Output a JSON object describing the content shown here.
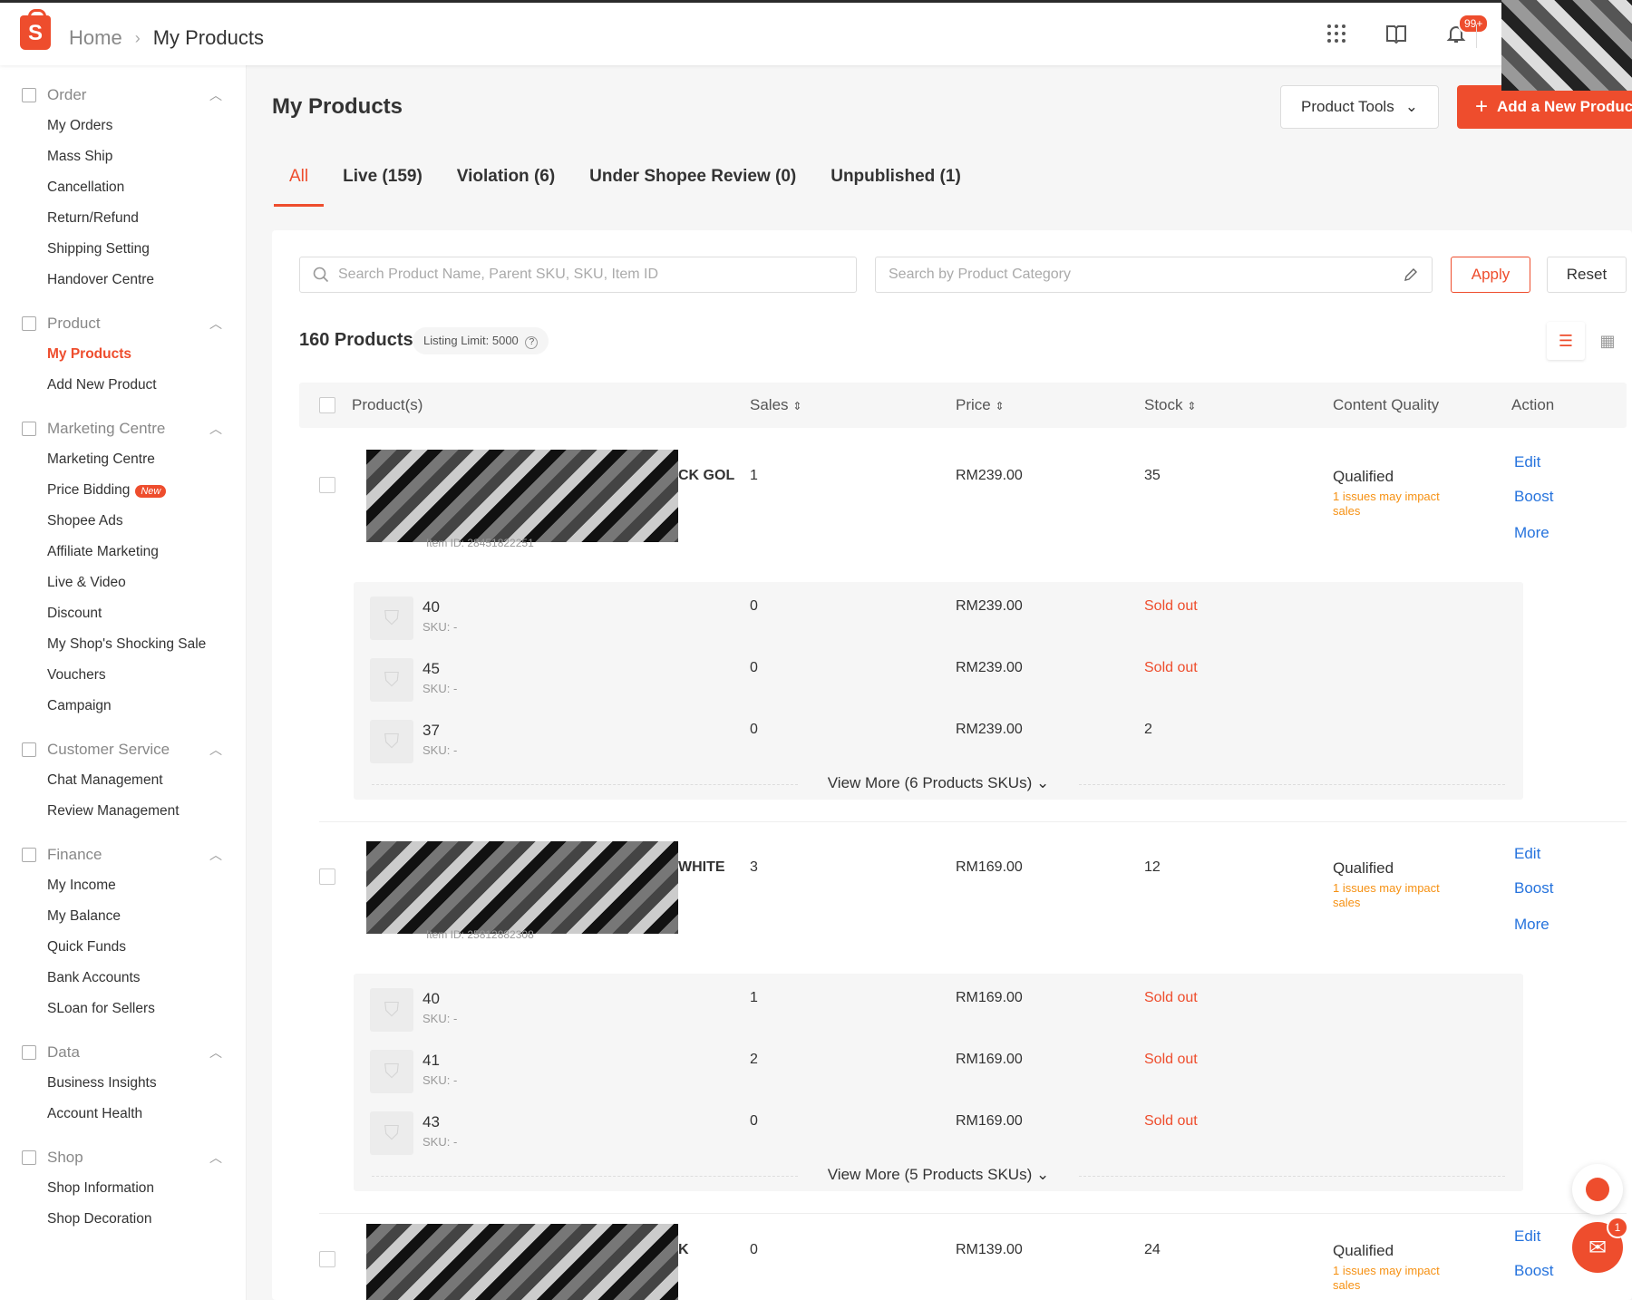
{
  "header": {
    "breadcrumb_home": "Home",
    "breadcrumb_current": "My Products",
    "notification_badge": "99+"
  },
  "sidebar": {
    "sections": [
      {
        "title": "Order",
        "items": [
          "My Orders",
          "Mass Ship",
          "Cancellation",
          "Return/Refund",
          "Shipping Setting",
          "Handover Centre"
        ]
      },
      {
        "title": "Product",
        "items": [
          "My Products",
          "Add New Product"
        ]
      },
      {
        "title": "Marketing Centre",
        "items": [
          "Marketing Centre",
          "Price Bidding",
          "Shopee Ads",
          "Affiliate Marketing",
          "Live & Video",
          "Discount",
          "My Shop's Shocking Sale",
          "Vouchers",
          "Campaign"
        ]
      },
      {
        "title": "Customer Service",
        "items": [
          "Chat Management",
          "Review Management"
        ]
      },
      {
        "title": "Finance",
        "items": [
          "My Income",
          "My Balance",
          "Quick Funds",
          "Bank Accounts",
          "SLoan for Sellers"
        ]
      },
      {
        "title": "Data",
        "items": [
          "Business Insights",
          "Account Health"
        ]
      },
      {
        "title": "Shop",
        "items": [
          "Shop Information",
          "Shop Decoration"
        ]
      }
    ],
    "new_tag": "New"
  },
  "main": {
    "title": "My Products",
    "product_tools": "Product Tools",
    "add_new": "Add a New Product",
    "tabs": [
      "All",
      "Live (159)",
      "Violation (6)",
      "Under Shopee Review (0)",
      "Unpublished (1)"
    ],
    "search_placeholder": "Search Product Name, Parent SKU, SKU, Item ID",
    "category_placeholder": "Search by Product Category",
    "apply": "Apply",
    "reset": "Reset",
    "count": "160 Products",
    "listing_limit": "Listing Limit: 5000"
  },
  "table": {
    "headers": {
      "product": "Product(s)",
      "sales": "Sales",
      "price": "Price",
      "stock": "Stock",
      "quality": "Content Quality",
      "action": "Action"
    },
    "actions": {
      "edit": "Edit",
      "boost": "Boost",
      "more": "More"
    },
    "products": [
      {
        "name_tail": "CK GOL",
        "item_id": "Item ID: 28451822251",
        "sales": "1",
        "price": "RM239.00",
        "stock": "35",
        "quality": "Qualified",
        "issue": "1 issues may impact sales",
        "variations": [
          {
            "name": "40",
            "sku": "SKU: -",
            "sales": "0",
            "price": "RM239.00",
            "stock": "Sold out"
          },
          {
            "name": "45",
            "sku": "SKU: -",
            "sales": "0",
            "price": "RM239.00",
            "stock": "Sold out"
          },
          {
            "name": "37",
            "sku": "SKU: -",
            "sales": "0",
            "price": "RM239.00",
            "stock": "2"
          }
        ],
        "view_more": "View More (6 Products SKUs)"
      },
      {
        "name_tail": "WHITE",
        "item_id": "Item ID: 25812882308",
        "sales": "3",
        "price": "RM169.00",
        "stock": "12",
        "quality": "Qualified",
        "issue": "1 issues may impact sales",
        "variations": [
          {
            "name": "40",
            "sku": "SKU: -",
            "sales": "1",
            "price": "RM169.00",
            "stock": "Sold out"
          },
          {
            "name": "41",
            "sku": "SKU: -",
            "sales": "2",
            "price": "RM169.00",
            "stock": "Sold out"
          },
          {
            "name": "43",
            "sku": "SKU: -",
            "sales": "0",
            "price": "RM169.00",
            "stock": "Sold out"
          }
        ],
        "view_more": "View More (5 Products SKUs)"
      },
      {
        "name_tail": "K",
        "sales": "0",
        "price": "RM139.00",
        "stock": "24",
        "quality": "Qualified",
        "issue": "1 issues may impact sales"
      }
    ]
  },
  "chat_badge": "1",
  "colors": {
    "brand": "#ee4d2d",
    "link": "#2673dd",
    "warning": "#f69113"
  },
  "icons": [
    "shopee-logo-icon",
    "apps-grid-icon",
    "book-icon",
    "bell-icon",
    "search-icon",
    "edit-pencil-icon",
    "list-view-icon",
    "grid-view-icon",
    "help-circle-icon",
    "sort-icon",
    "chevron-down-icon",
    "chevron-up-icon",
    "chat-icon"
  ]
}
